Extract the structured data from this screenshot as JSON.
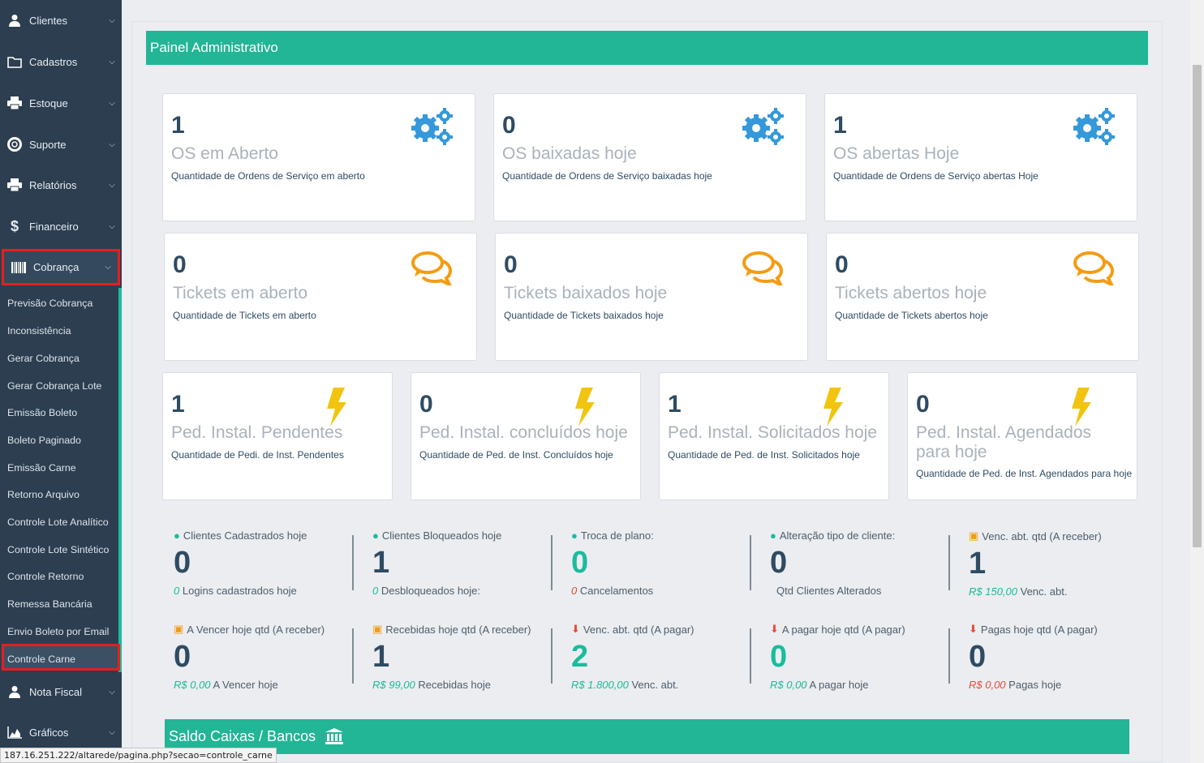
{
  "sidebar": {
    "items": [
      {
        "label": "Clientes",
        "icon": "user-icon"
      },
      {
        "label": "Cadastros",
        "icon": "folder-icon"
      },
      {
        "label": "Estoque",
        "icon": "printer-icon"
      },
      {
        "label": "Suporte",
        "icon": "lifebuoy-icon"
      },
      {
        "label": "Relatórios",
        "icon": "printer-icon"
      },
      {
        "label": "Financeiro",
        "icon": "dollar-icon"
      },
      {
        "label": "Cobrança",
        "icon": "barcode-icon"
      },
      {
        "label": "Nota Fiscal",
        "icon": "user-icon"
      },
      {
        "label": "Gráficos",
        "icon": "area-chart-icon"
      }
    ],
    "sub": [
      "Previsão Cobrança",
      "Inconsistência",
      "Gerar Cobrança",
      "Gerar Cobrança Lote",
      "Emissão Boleto",
      "Boleto Paginado",
      "Emissão Carne",
      "Retorno Arquivo",
      "Controle Lote Analítico",
      "Controle Lote Sintético",
      "Controle Retorno",
      "Remessa Bancária",
      "Envio Boleto por Email",
      "Controle Carne"
    ]
  },
  "status_url": "187.16.251.222/altarede/pagina.php?secao=controle_carne",
  "panel_title": "Painel Administrativo",
  "cards": {
    "os": [
      {
        "num": "1",
        "title": "OS em Aberto",
        "desc": "Quantidade de Ordens de Serviço em aberto"
      },
      {
        "num": "0",
        "title": "OS baixadas hoje",
        "desc": "Quantidade de Ordens de Serviço baixadas hoje"
      },
      {
        "num": "1",
        "title": "OS abertas Hoje",
        "desc": "Quantidade de Ordens de Serviço abertas Hoje"
      }
    ],
    "tickets": [
      {
        "num": "0",
        "title": "Tickets em aberto",
        "desc": "Quantidade de Tickets em aberto"
      },
      {
        "num": "0",
        "title": "Tickets baixados hoje",
        "desc": "Quantidade de Tickets baixados hoje"
      },
      {
        "num": "0",
        "title": "Tickets abertos hoje",
        "desc": "Quantidade de Tickets abertos hoje"
      }
    ],
    "ped": [
      {
        "num": "1",
        "title": "Ped. Instal. Pendentes",
        "desc": "Quantidade de Pedi. de Inst. Pendentes"
      },
      {
        "num": "0",
        "title": "Ped. Instal. concluídos hoje",
        "desc": "Quantidade de Ped. de Inst. Concluídos hoje"
      },
      {
        "num": "1",
        "title": "Ped. Instal. Solicitados hoje",
        "desc": "Quantidade de Ped. de Inst. Solicitados hoje"
      },
      {
        "num": "0",
        "title": "Ped. Instal. Agendados para hoje",
        "desc": "Quantidade de Ped. de Inst. Agendados para hoje"
      }
    ]
  },
  "stats_row1": [
    {
      "header": "Clientes Cadastrados hoje",
      "icon": "user-icon",
      "value": "0",
      "sub_em": "0",
      "sub": "Logins cadastrados hoje",
      "em_color": "#1abc9c"
    },
    {
      "header": "Clientes Bloqueados hoje",
      "icon": "user-icon",
      "value": "1",
      "sub_em": "0",
      "sub": "Desbloqueados hoje:",
      "em_color": "#1abc9c"
    },
    {
      "header": "Troca de plano:",
      "icon": "user-icon",
      "value": "0",
      "sub_em": "0",
      "sub": "Cancelamentos",
      "em_color": "#e74c3c",
      "green": true
    },
    {
      "header": "Alteração tipo de cliente:",
      "icon": "user-icon",
      "value": "0",
      "sub_em": "",
      "sub": "Qtd Clientes Alterados",
      "em_color": "#1abc9c"
    },
    {
      "header": "Venc. abt. qtd (A receber)",
      "icon": "money-icon",
      "value": "1",
      "sub_em": "R$ 150,00",
      "sub": "Venc. abt.",
      "em_color": "#1abc9c"
    }
  ],
  "stats_row2": [
    {
      "header": "A Vencer hoje qtd (A receber)",
      "icon": "money-icon",
      "value": "0",
      "sub_em": "R$ 0,00",
      "sub": "A Vencer hoje",
      "em_color": "#1abc9c"
    },
    {
      "header": "Recebidas hoje qtd (A receber)",
      "icon": "money-icon",
      "value": "1",
      "sub_em": "R$ 99,00",
      "sub": "Recebidas hoje",
      "em_color": "#1abc9c"
    },
    {
      "header": "Venc. abt. qtd (A pagar)",
      "icon": "arrow-circle-icon",
      "value": "2",
      "sub_em": "R$ 1.800,00",
      "sub": "Venc. abt.",
      "em_color": "#1abc9c",
      "green": true
    },
    {
      "header": "A pagar hoje qtd (A pagar)",
      "icon": "arrow-circle-icon",
      "value": "0",
      "sub_em": "R$ 0,00",
      "sub": "A pagar hoje",
      "em_color": "#1abc9c",
      "green": true
    },
    {
      "header": "Pagas hoje qtd (A pagar)",
      "icon": "arrow-circle-icon",
      "value": "0",
      "sub_em": "R$ 0,00",
      "sub": "Pagas hoje",
      "em_color": "#e74c3c"
    }
  ],
  "saldo_title": "Saldo Caixas / Bancos",
  "colors": {
    "accent": "#22b596",
    "sidebar": "#2c3e50",
    "gear": "#3498db",
    "chat": "#f39c12",
    "bolt": "#f1c40f",
    "highlight": "#e41f1f"
  }
}
